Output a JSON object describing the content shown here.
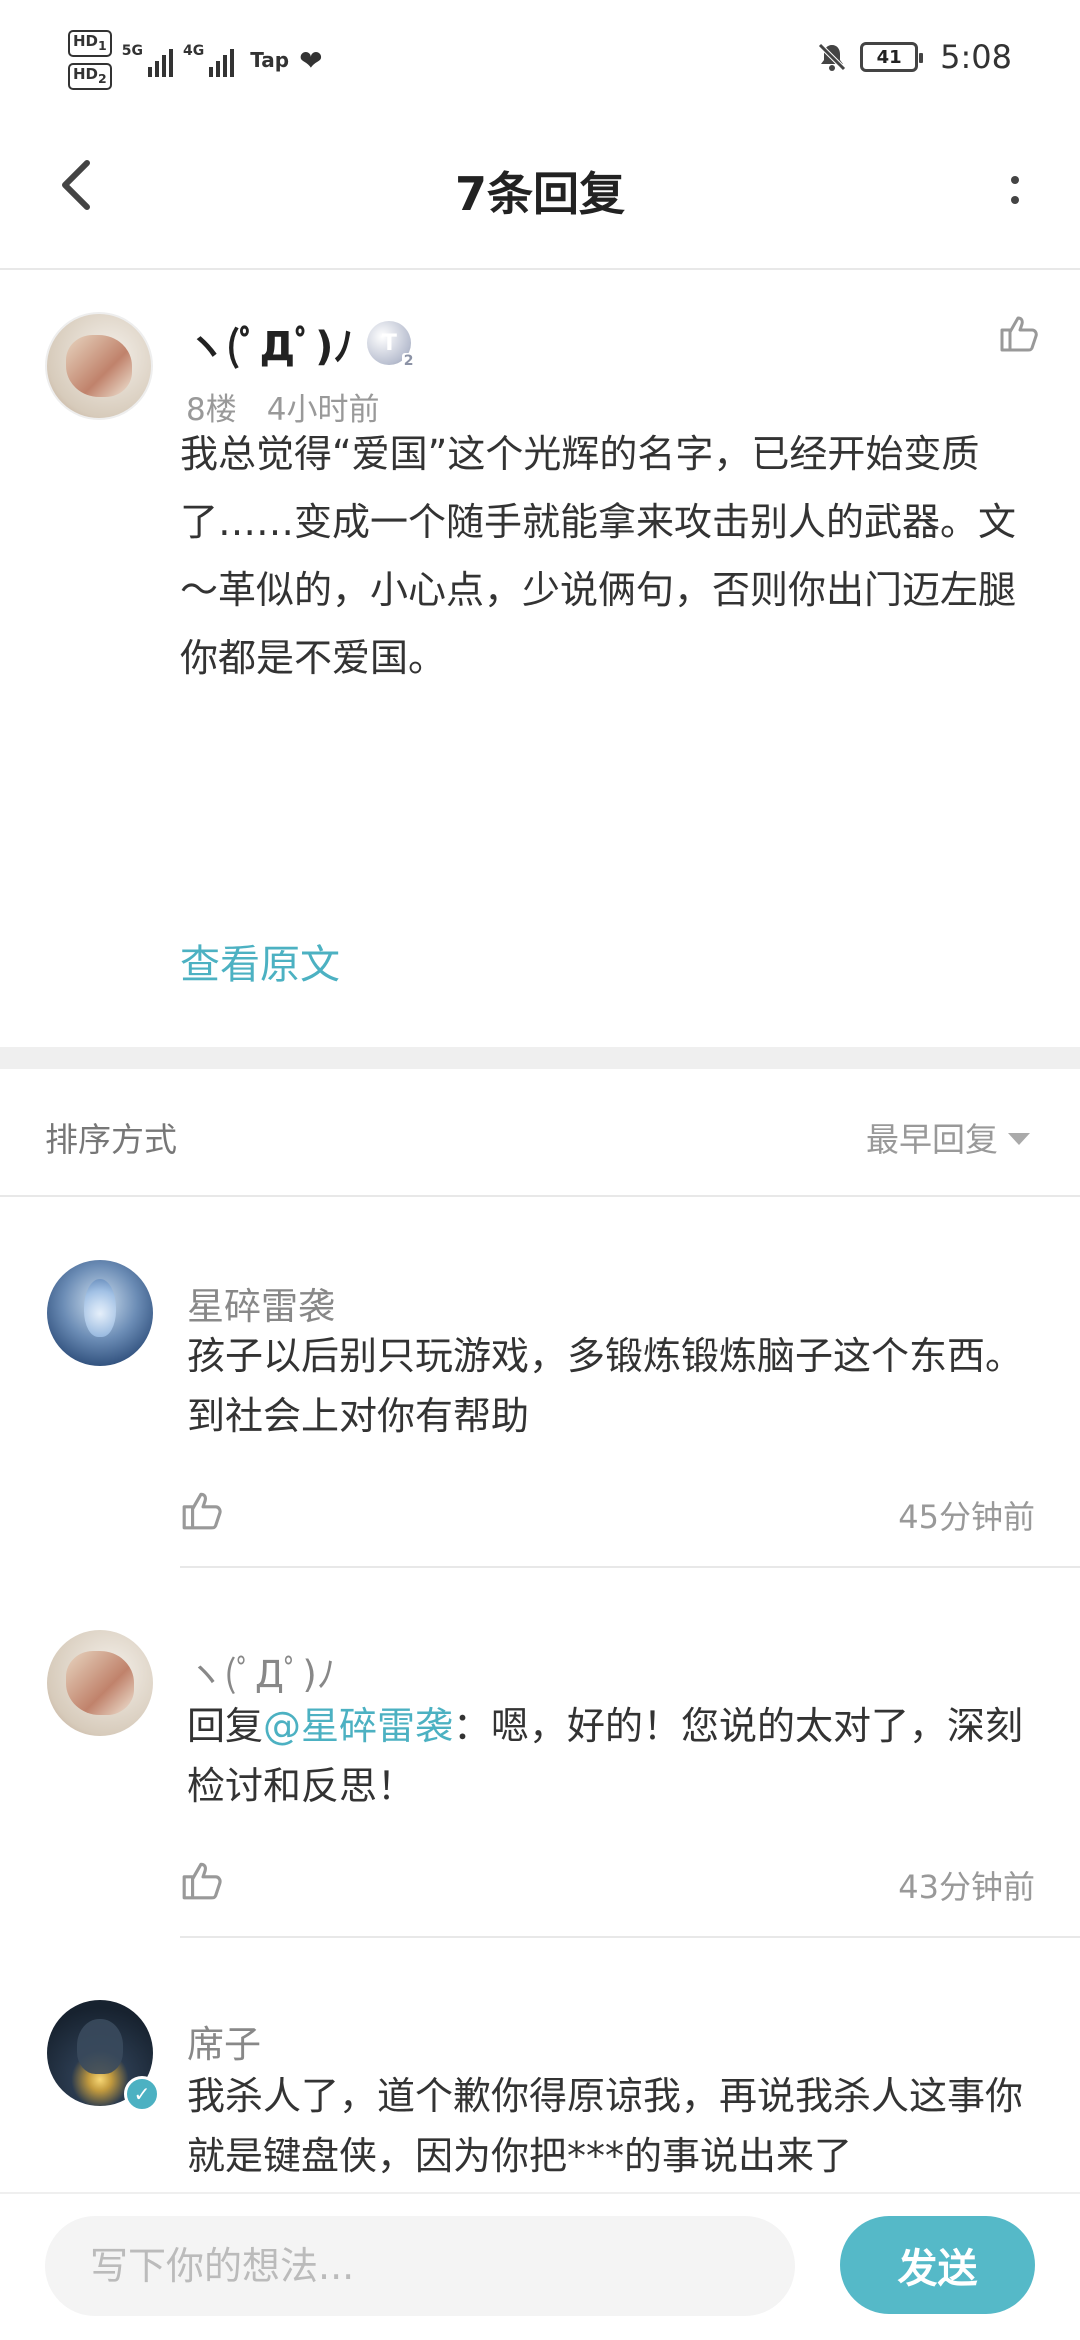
{
  "status_bar": {
    "hd1": "HD",
    "hd1_sub": "1",
    "hd2": "HD",
    "hd2_sub": "2",
    "net1": "5G",
    "net2": "4G",
    "carrier_app": "Tap",
    "battery": "41",
    "time": "5:08",
    "icons": [
      "hd-icon",
      "signal-icon",
      "heart-pulse-icon",
      "mute-bell-icon",
      "battery-icon"
    ]
  },
  "header": {
    "title": "7条回复",
    "icons": [
      "back-icon",
      "more-icon"
    ]
  },
  "post": {
    "username": "ヽ(ﾟДﾟ)ﾉ",
    "badge_letter": "T",
    "badge_level": "2",
    "floor": "8楼",
    "time": "4小时前",
    "text": "我总觉得“爱国”这个光辉的名字，已经开始变质了……变成一个随手就能拿来攻击别人的武器。文～革似的，小心点，少说俩句，否则你出门迈左腿你都是不爱国。",
    "view_original": "查看原文"
  },
  "sort": {
    "label": "排序方式",
    "value": "最早回复"
  },
  "replies": [
    {
      "username": "星碎雷袭",
      "text": "孩子以后别只玩游戏，多锻炼锻炼脑子这个东西。到社会上对你有帮助",
      "time": "45分钟前"
    },
    {
      "username": "ヽ(ﾟДﾟ)ﾉ",
      "reply_prefix": "回复",
      "mention": "@星碎雷袭",
      "text": "：嗯，好的！您说的太对了，深刻检讨和反思！",
      "time": "43分钟前"
    },
    {
      "username": "席子",
      "text": "我杀人了，道个歉你得原谅我，再说我杀人这事你就是键盘侠，因为你把***的事说出来了"
    }
  ],
  "composer": {
    "placeholder": "写下你的想法...",
    "value": "",
    "send_label": "发送"
  },
  "colors": {
    "accent": "#4cb1c2",
    "send_button": "#55b9c8",
    "text_primary": "#333333",
    "text_secondary": "#999999"
  }
}
